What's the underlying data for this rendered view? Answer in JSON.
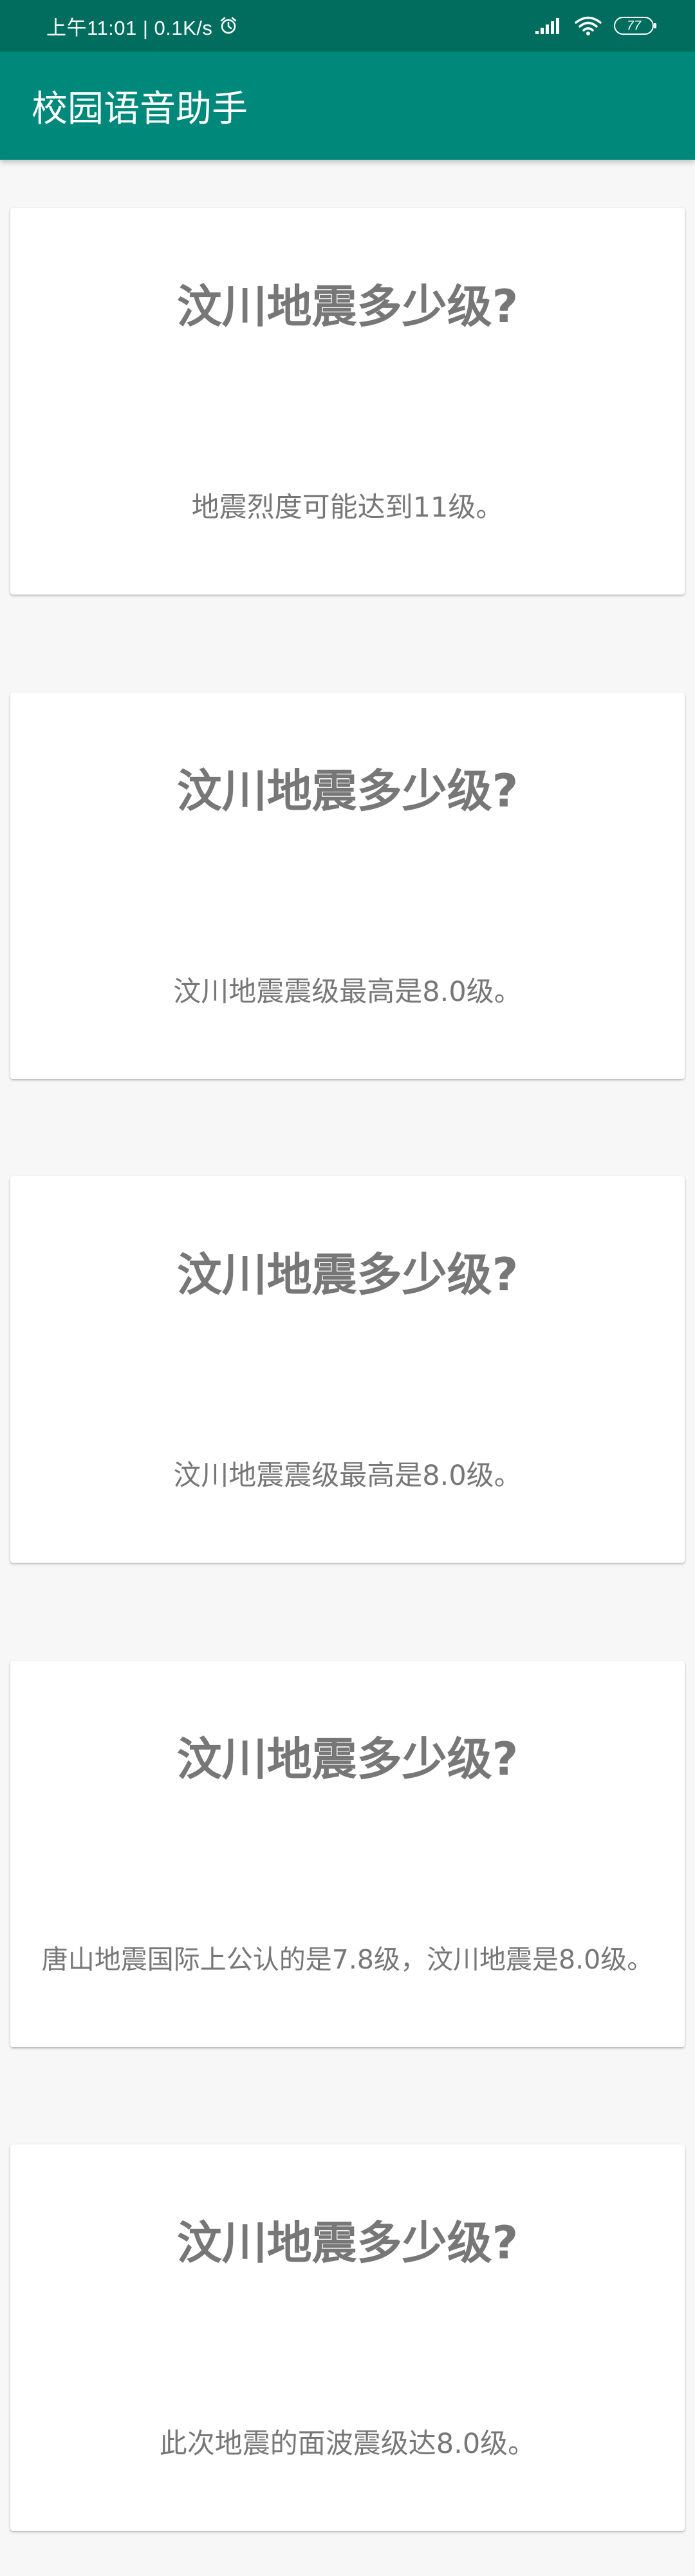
{
  "status_bar": {
    "time_speed": "上午11:01 | 0.1K/s",
    "battery": "77",
    "icons": [
      "alarm-icon",
      "signal-icon",
      "wifi-icon",
      "battery-icon"
    ]
  },
  "app_bar": {
    "title": "校园语音助手",
    "color": "#00897b"
  },
  "cards": [
    {
      "question": "汶川地震多少级?",
      "answer": "地震烈度可能达到11级。"
    },
    {
      "question": "汶川地震多少级?",
      "answer": "汶川地震震级最高是8.0级。"
    },
    {
      "question": "汶川地震多少级?",
      "answer": "汶川地震震级最高是8.0级。"
    },
    {
      "question": "汶川地震多少级?",
      "answer": "唐山地震国际上公认的是7.8级，汶川地震是8.0级。"
    },
    {
      "question": "汶川地震多少级?",
      "answer": "此次地震的面波震级达8.0级。"
    }
  ]
}
